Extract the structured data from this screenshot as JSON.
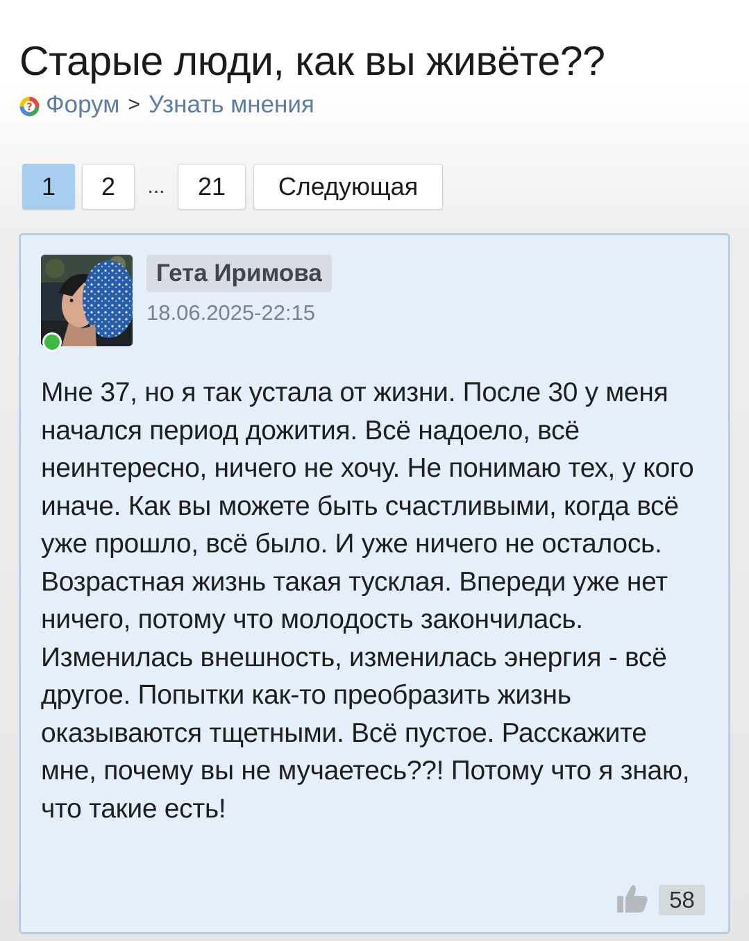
{
  "header": {
    "title": "Старые люди, как вы живёте??"
  },
  "breadcrumb": {
    "forum": "Форум",
    "separator": ">",
    "section": "Узнать мнения"
  },
  "pagination": {
    "pages": [
      "1",
      "2"
    ],
    "ellipsis": "...",
    "last": "21",
    "next": "Следующая",
    "current": "1"
  },
  "post": {
    "author": "Гета Иримова",
    "date": "18.06.2025-22:15",
    "online": true,
    "text": "Мне 37, но я так устала от жизни. После 30 у меня начался период дожития. Всё надоело, всё неинтересно, ничего не хочу. Не понимаю тех, у кого иначе. Как вы можете быть счастливыми, когда всё уже прошло, всё было. И уже ничего не осталось. Возрастная жизнь такая тусклая. Впереди уже нет ничего, потому что молодость закончилась. Изменилась внешность, изменилась энергия - всё другое. Попытки как-то преобразить жизнь оказываются тщетными. Всё пустое. Расскажите мне, почему вы не мучаетесь??! Потому что я знаю, что такие есть!",
    "likes": "58"
  },
  "icons": {
    "forum": "forum-question-icon",
    "like": "thumbs-up-icon"
  },
  "colors": {
    "link": "#5f7ca1",
    "active_page": "#a7cdef",
    "post_background": "#e5eff9",
    "post_border": "#b7cde2",
    "online": "#3dba3f"
  }
}
